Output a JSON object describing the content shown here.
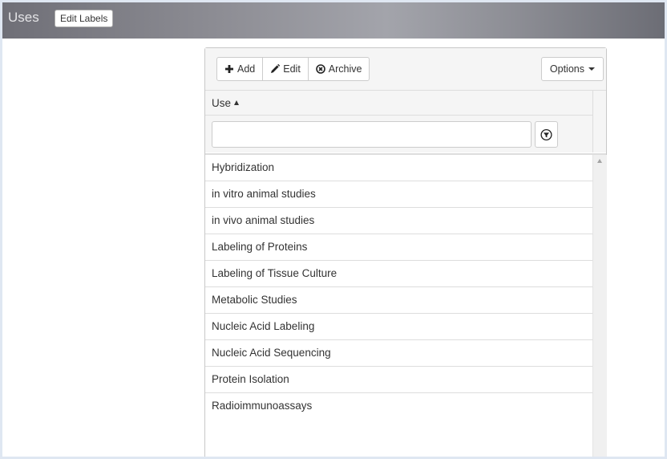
{
  "header": {
    "title": "Uses",
    "edit_labels_button": "Edit Labels"
  },
  "toolbar": {
    "add_label": "Add",
    "edit_label": "Edit",
    "archive_label": "Archive",
    "options_label": "Options"
  },
  "grid": {
    "column_header": "Use",
    "sort": "ascending",
    "filter": {
      "value": "",
      "placeholder": ""
    },
    "rows": [
      "Hybridization",
      "in vitro animal studies",
      "in vivo animal studies",
      "Labeling of Proteins",
      "Labeling of Tissue Culture",
      "Metabolic Studies",
      "Nucleic Acid Labeling",
      "Nucleic Acid Sequencing",
      "Protein Isolation",
      "Radioimmunoassays"
    ]
  },
  "colors": {
    "header_gradient_mid": "#a3a4ab",
    "header_gradient_edge": "#6f6f77",
    "panel_bg": "#f5f5f5",
    "border": "#dddddd",
    "text": "#333333"
  },
  "icons": {
    "add": "plus-icon",
    "edit": "pencil-icon",
    "archive": "circle-x-icon",
    "options": "caret-down-icon",
    "filter": "filter-icon",
    "sort": "sort-up-icon"
  }
}
